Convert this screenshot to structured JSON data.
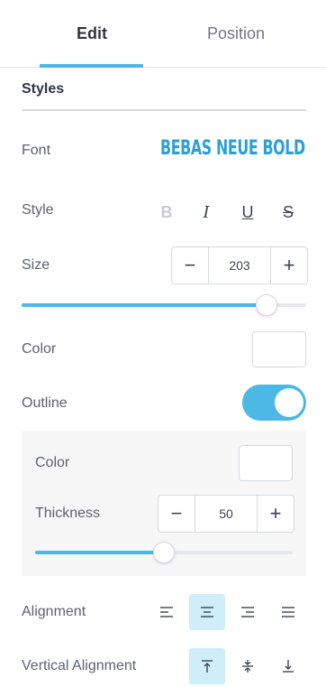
{
  "tabs": [
    {
      "label": "Edit",
      "active": true
    },
    {
      "label": "Position",
      "active": false
    }
  ],
  "section": {
    "title": "Styles"
  },
  "font": {
    "label": "Font",
    "value": "BEBAS NEUE BOLD",
    "color": "#2b9fd8"
  },
  "style": {
    "label": "Style",
    "buttons": [
      {
        "name": "bold",
        "glyph": "B",
        "enabled": false
      },
      {
        "name": "italic",
        "glyph": "I",
        "enabled": true
      },
      {
        "name": "underline",
        "glyph": "U",
        "enabled": true
      },
      {
        "name": "strikethrough",
        "glyph": "S",
        "enabled": true
      }
    ]
  },
  "size": {
    "label": "Size",
    "value": "203",
    "decrement": "−",
    "increment": "+",
    "slider_fraction": 0.86
  },
  "color": {
    "label": "Color",
    "value": "#ffffff"
  },
  "outline": {
    "label": "Outline",
    "enabled": true,
    "color": {
      "label": "Color",
      "value": "#ffffff"
    },
    "thickness": {
      "label": "Thickness",
      "value": "50",
      "decrement": "−",
      "increment": "+",
      "slider_fraction": 0.5
    }
  },
  "alignment": {
    "label": "Alignment",
    "options": [
      "left",
      "center",
      "right",
      "justify"
    ],
    "selected": "center"
  },
  "vertical_alignment": {
    "label": "Vertical Alignment",
    "options": [
      "top",
      "middle",
      "bottom"
    ],
    "selected": "top"
  },
  "accent_color": "#4cb8e6",
  "active_bg_color": "#cfeef9"
}
